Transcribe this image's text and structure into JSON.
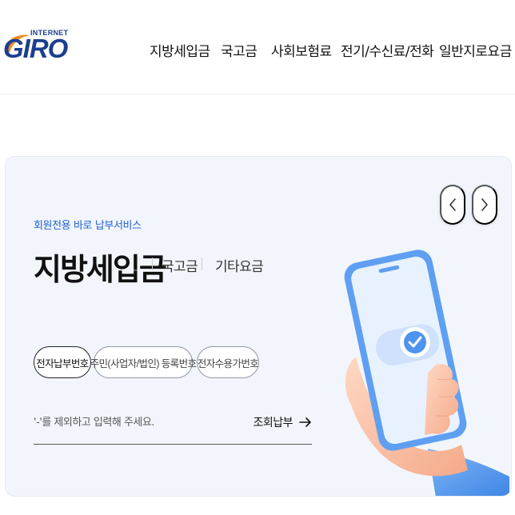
{
  "header": {
    "logo": {
      "small_text": "INTERNET",
      "main_text": "GIRO"
    },
    "nav": [
      {
        "label": "지방세입금"
      },
      {
        "label": "국고금"
      },
      {
        "label": "사회보험료"
      },
      {
        "label": "전기/수신료/전화"
      },
      {
        "label": "일반지로요금"
      }
    ]
  },
  "hero": {
    "subtitle": "회원전용 바로 납부서비스",
    "title": "지방세입금",
    "tabs": [
      {
        "label": "국고금"
      },
      {
        "label": "기타요금"
      }
    ],
    "search_types": [
      {
        "label": "전자납부번호",
        "active": true
      },
      {
        "label": "주민(사업자/법인) 등록번호",
        "active": false
      },
      {
        "label": "전자수용가번호",
        "active": false
      }
    ],
    "input": {
      "placeholder": "'-'를 제외하고 입력해 주세요.",
      "value": ""
    },
    "submit_label": "조회납부",
    "carousel": {
      "prev_icon": "chevron-left-icon",
      "next_icon": "chevron-right-icon"
    }
  },
  "colors": {
    "brand": "#1b3f8f",
    "accent": "#1f5fd6",
    "card_bg": "#f2f6fc",
    "phone_blue": "#6aa6f5"
  }
}
